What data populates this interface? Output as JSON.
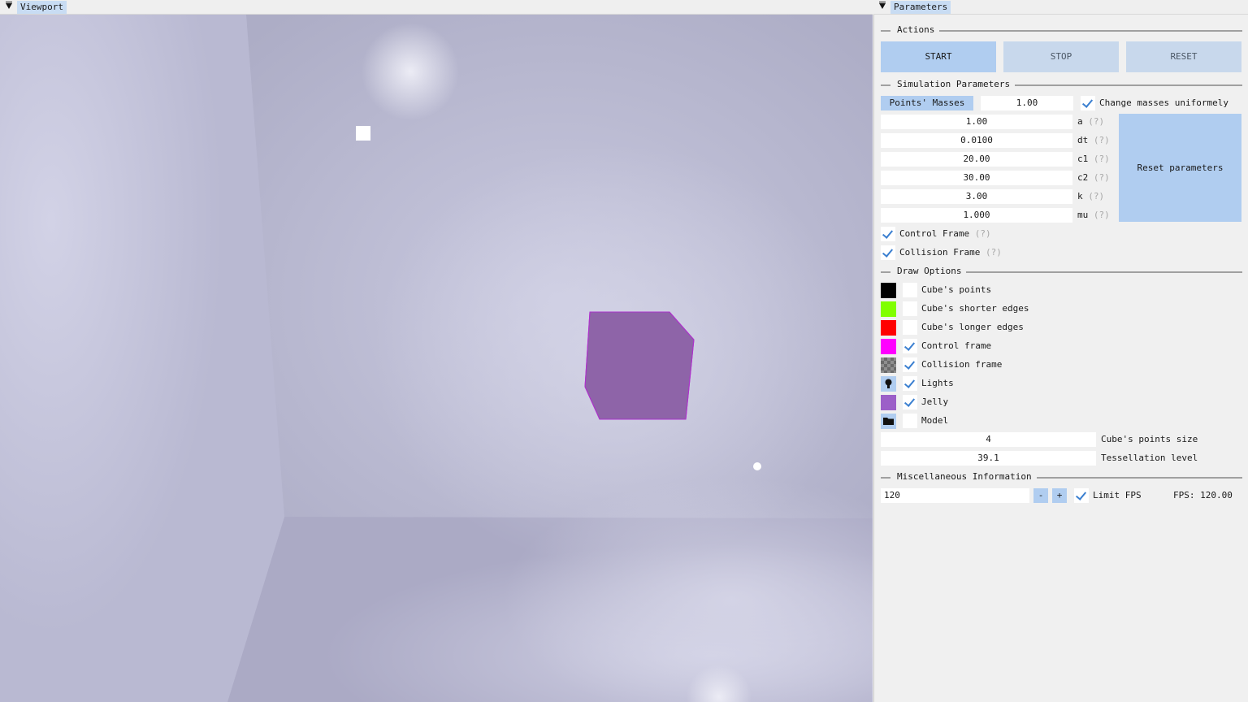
{
  "viewport": {
    "title": "Viewport"
  },
  "panel": {
    "title": "Parameters",
    "actions": {
      "heading": "Actions",
      "start": "START",
      "stop": "STOP",
      "reset": "RESET"
    },
    "sim": {
      "heading": "Simulation Parameters",
      "masses_button": "Points' Masses",
      "masses_value": "1.00",
      "change_uniform_label": "Change masses uniformely",
      "change_uniform_checked": true,
      "params": [
        {
          "value": "1.00",
          "label": "a"
        },
        {
          "value": "0.0100",
          "label": "dt"
        },
        {
          "value": "20.00",
          "label": "c1"
        },
        {
          "value": "30.00",
          "label": "c2"
        },
        {
          "value": "3.00",
          "label": "k"
        },
        {
          "value": "1.000",
          "label": "mu"
        }
      ],
      "help_mark": "(?)",
      "reset_params": "Reset parameters",
      "control_frame_label": "Control Frame",
      "collision_frame_label": "Collision Frame"
    },
    "draw": {
      "heading": "Draw Options",
      "items": [
        {
          "label": "Cube's points",
          "color": "#000000",
          "checked": false
        },
        {
          "label": "Cube's shorter edges",
          "color": "#80ff00",
          "checked": false
        },
        {
          "label": "Cube's longer edges",
          "color": "#ff0000",
          "checked": false
        },
        {
          "label": "Control frame",
          "color": "#ff00ff",
          "checked": true
        },
        {
          "label": "Collision frame",
          "color": "#808080",
          "checked": true
        },
        {
          "label": "Lights",
          "icon": "lightbulb-icon",
          "checked": true
        },
        {
          "label": "Jelly",
          "color": "#9c5fc8",
          "checked": true
        },
        {
          "label": "Model",
          "icon": "folder-icon",
          "checked": false
        }
      ],
      "points_size_value": "4",
      "points_size_label": "Cube's points size",
      "tessellation_value": "39.1",
      "tessellation_label": "Tessellation level"
    },
    "misc": {
      "heading": "Miscellaneous Information",
      "fps_input": "120",
      "minus": "-",
      "plus": "+",
      "limit_fps_label": "Limit FPS",
      "fps_readout": "FPS: 120.00"
    }
  }
}
